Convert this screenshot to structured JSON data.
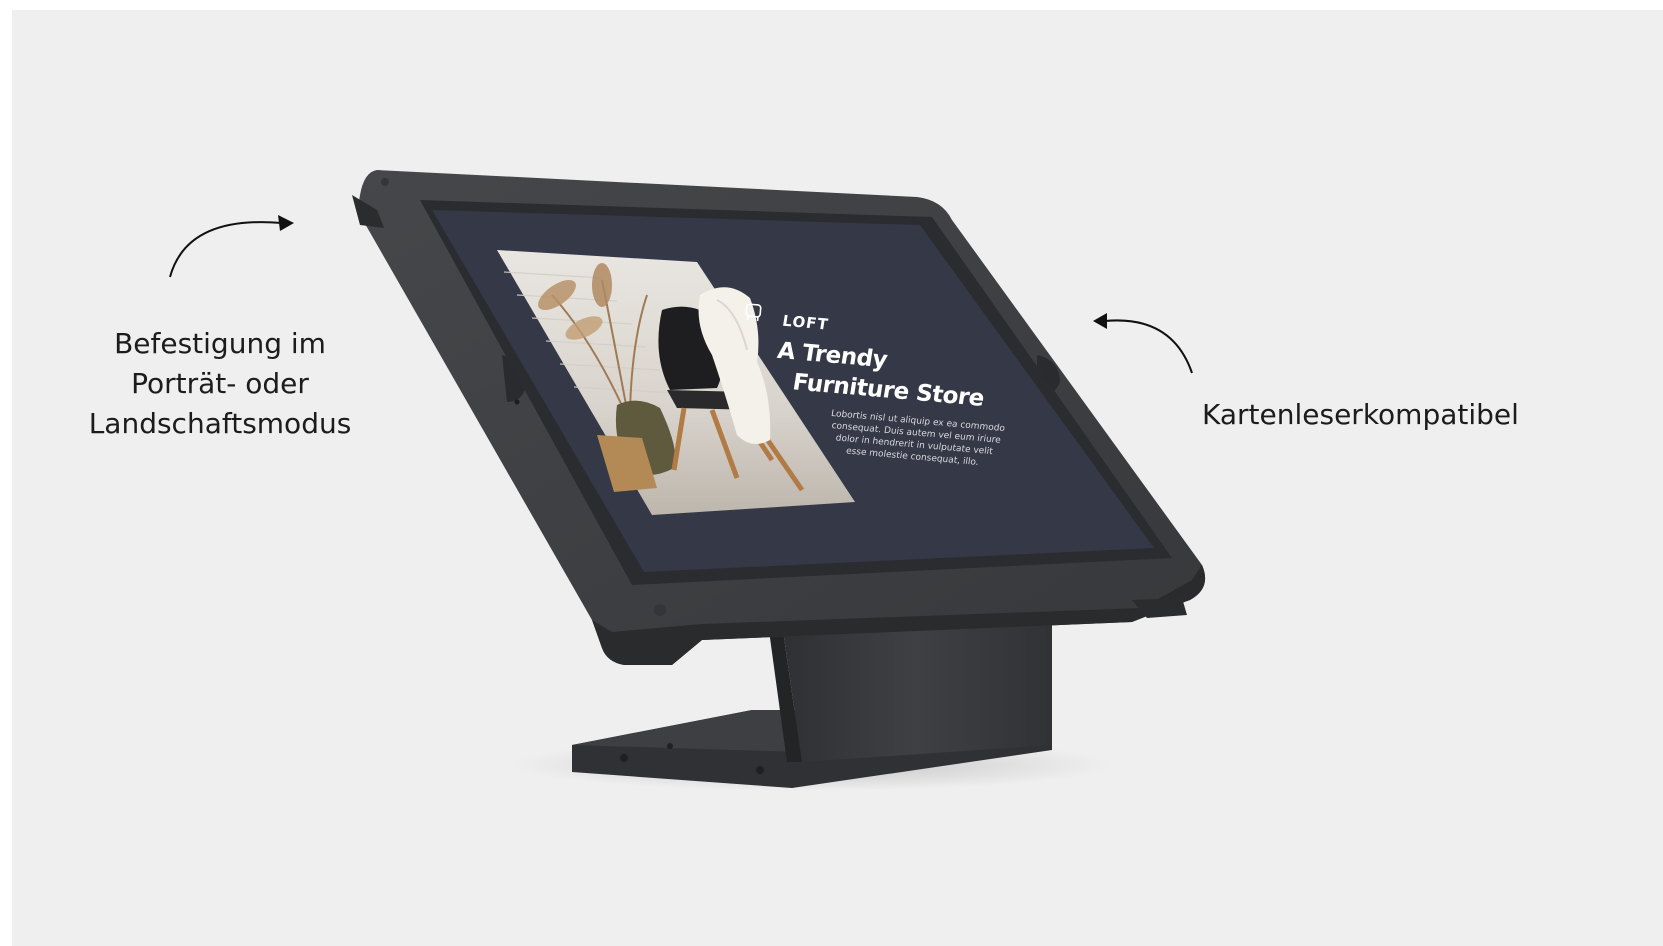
{
  "annotations": {
    "left_caption_lines": [
      "Befestigung im",
      "Porträt- oder",
      "Landschaftsmodus"
    ],
    "right_caption": "Kartenleserkompatibel"
  },
  "screen": {
    "logo_text": "LOFT",
    "logo_icon": "chair-logo-icon",
    "title_lines": [
      "A Trendy",
      "Furniture Store"
    ],
    "body_lines": [
      "Lobortis nisl ut aliquip ex ea commodo",
      "consequat. Duis autem vel eum iriure",
      "dolor in hendrerit in vulputate velit",
      "esse molestie consequat, illo."
    ]
  },
  "colors": {
    "background": "#efefef",
    "frame": "#3f4144",
    "frame_edge": "#2b2c2e",
    "screen": "#353846",
    "stand": "#3a3c3f",
    "text": "#1c1c1c"
  }
}
